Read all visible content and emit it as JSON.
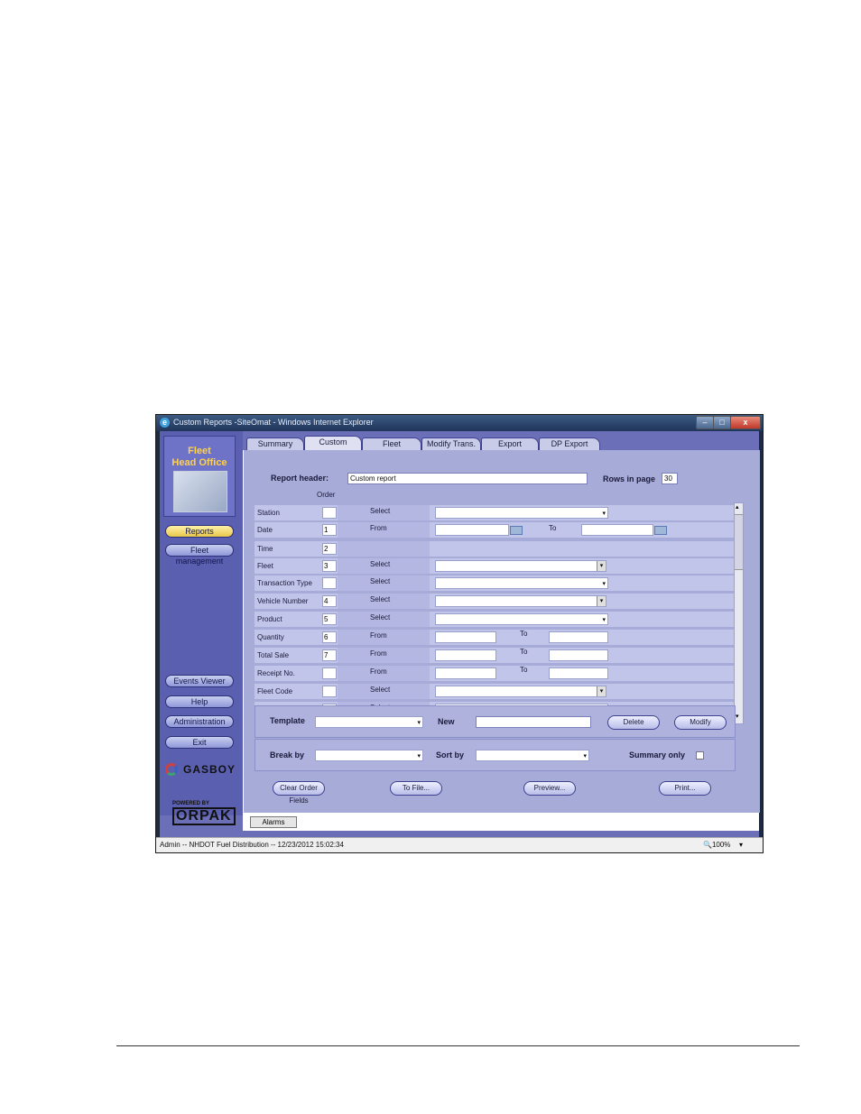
{
  "window": {
    "title": "Custom Reports -SiteOmat - Windows Internet Explorer",
    "min": "–",
    "max": "□",
    "close": "x"
  },
  "sidebar": {
    "logo_line1": "Fleet",
    "logo_line2": "Head Office",
    "nav": [
      "Reports",
      "Fleet management",
      "Events Viewer",
      "Help",
      "Administration",
      "Exit"
    ],
    "brand": "GASBOY",
    "powered_by": "POWERED BY",
    "powered_logo": "ORPAK"
  },
  "tabs": [
    "Summary",
    "Custom",
    "Fleet",
    "Modify Trans.",
    "Export",
    "DP Export"
  ],
  "header": {
    "report_header_label": "Report header:",
    "report_header_value": "Custom report",
    "rows_label": "Rows in page",
    "rows_value": "30",
    "order_label": "Order"
  },
  "filters": [
    {
      "field": "Station",
      "order": "",
      "op": "Select",
      "kind": "dd"
    },
    {
      "field": "Date",
      "order": "1",
      "op": "From",
      "kind": "date",
      "to": "To"
    },
    {
      "field": "Time",
      "order": "2",
      "op": "",
      "kind": "none"
    },
    {
      "field": "Fleet",
      "order": "3",
      "op": "Select",
      "kind": "ddbox"
    },
    {
      "field": "Transaction Type",
      "order": "",
      "op": "Select",
      "kind": "dd"
    },
    {
      "field": "Vehicle Number",
      "order": "4",
      "op": "Select",
      "kind": "ddbox"
    },
    {
      "field": "Product",
      "order": "5",
      "op": "Select",
      "kind": "dd"
    },
    {
      "field": "Quantity",
      "order": "6",
      "op": "From",
      "kind": "range",
      "to": "To"
    },
    {
      "field": "Total Sale",
      "order": "7",
      "op": "From",
      "kind": "range",
      "to": "To"
    },
    {
      "field": "Receipt No.",
      "order": "",
      "op": "From",
      "kind": "range",
      "to": "To"
    },
    {
      "field": "Fleet Code",
      "order": "",
      "op": "Select",
      "kind": "ddbox"
    },
    {
      "field": "Pay Mode",
      "order": "",
      "op": "Select",
      "kind": "dd"
    }
  ],
  "template": {
    "label": "Template",
    "new_label": "New",
    "delete": "Delete",
    "modify": "Modify"
  },
  "grouping": {
    "break_by": "Break by",
    "sort_by": "Sort by",
    "summary_only": "Summary only"
  },
  "actions": [
    "Clear Order Fields",
    "To File...",
    "Preview...",
    "Print..."
  ],
  "alarms": "Alarms",
  "status": {
    "text": "Admin -- NHDOT Fuel Distribution -- 12/23/2012  15:02:34",
    "zoom": "🔍100%",
    "zoom_arrow": "▾"
  },
  "icons": {
    "ie": "e",
    "dropdown": "▾",
    "scroll_up": "▴",
    "scroll_down": "▾"
  }
}
